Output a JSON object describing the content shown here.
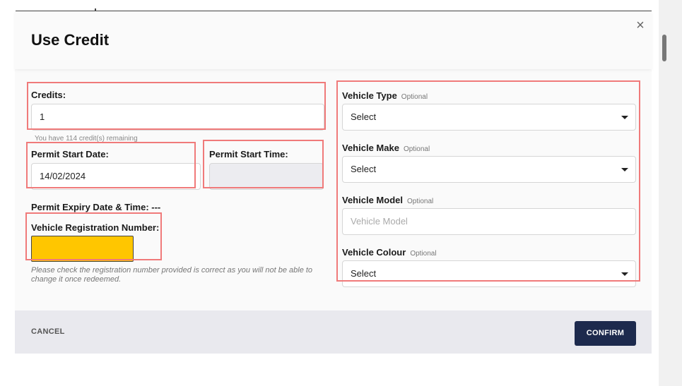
{
  "modal": {
    "title": "Use Credit",
    "close_glyph": "×"
  },
  "form": {
    "credits": {
      "label": "Credits:",
      "value": "1",
      "hint": "You have 114 credit(s) remaining"
    },
    "permit_start_date": {
      "label": "Permit Start Date:",
      "value": "14/02/2024"
    },
    "permit_start_time": {
      "label": "Permit Start Time:",
      "value": ""
    },
    "permit_expiry": {
      "label": "Permit Expiry Date & Time: ---"
    },
    "registration": {
      "label": "Vehicle Registration Number:",
      "value": "",
      "note": "Please check the registration number provided is correct as you will not be able to change it once redeemed."
    },
    "vehicle_type": {
      "label": "Vehicle Type",
      "optional": "Optional",
      "value": "Select"
    },
    "vehicle_make": {
      "label": "Vehicle Make",
      "optional": "Optional",
      "value": "Select"
    },
    "vehicle_model": {
      "label": "Vehicle Model",
      "optional": "Optional",
      "placeholder": "Vehicle Model"
    },
    "vehicle_colour": {
      "label": "Vehicle Colour",
      "optional": "Optional",
      "value": "Select"
    }
  },
  "footer": {
    "cancel_label": "CANCEL",
    "confirm_label": "CONFIRM"
  },
  "colors": {
    "confirm_bg": "#1d2a4d",
    "registration_bg": "#ffc600",
    "annotation": "#f07a7a"
  },
  "icons": {
    "close": "close-icon",
    "select_caret": "chevron-down-icon"
  }
}
